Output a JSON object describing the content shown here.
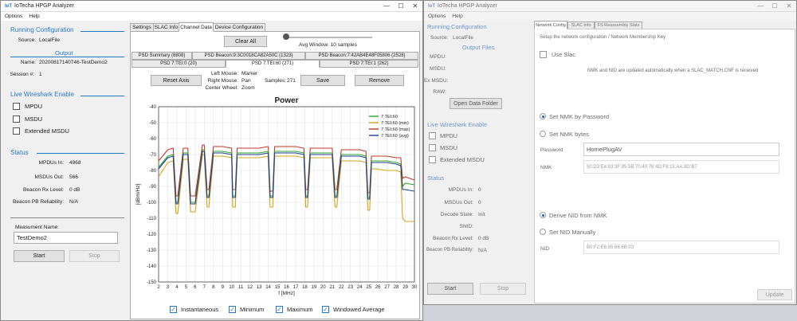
{
  "left_window": {
    "title": "IoTecha HPGP Analyzer",
    "menu": [
      "Options",
      "Help"
    ],
    "running_config": {
      "heading": "Running Configuration",
      "source_label": "Source:",
      "source_value": "LocalFile",
      "output_heading": "Output",
      "name_label": "Name:",
      "name_value": "20200817140746-TestDemo2",
      "session_label": "Session #:",
      "session_value": "1"
    },
    "wireshark": {
      "heading": "Live Wireshark Enable",
      "items": [
        "MPDU",
        "MSDU",
        "Extended MSDU"
      ]
    },
    "status": {
      "heading": "Status",
      "rows": [
        {
          "label": "MPDUs In:",
          "value": "4968"
        },
        {
          "label": "MSDUs Out:",
          "value": "566"
        },
        {
          "label": "Beacon Rx Level:",
          "value": "0 dB"
        },
        {
          "label": "Beacon PB Reliability:",
          "value": "N/A"
        }
      ]
    },
    "measurement": {
      "label": "Measument Name:",
      "value": "TestDemo2",
      "start": "Start",
      "stop": "Stop"
    },
    "tabs": [
      "Settings",
      "SLAC Info",
      "Channel Data",
      "Device Configuration"
    ],
    "clear_all": "Clear All",
    "avg_window": "Avg Window: 10 samples",
    "subtabs_row1": [
      "PSD Summary (8808)",
      "PSD Beacon:9:3C0018CA82A50C (1323)",
      "PSD Beacon:7:42AB4E48F05806 (2528)"
    ],
    "subtabs_row2": [
      "PSD 7:TEI:0 (20)",
      "PSD 7:TEI:60 (271)",
      "PSD 7:TEI:1 (262)"
    ],
    "reset_axis": "Reset Axis",
    "mouse_help": [
      {
        "k": "Left Mouse:",
        "v": "Marker"
      },
      {
        "k": "Right Mouse:",
        "v": "Pan"
      },
      {
        "k": "Center Wheel:",
        "v": "Zoom"
      }
    ],
    "samples_label": "Samples:",
    "samples_value": "271",
    "save": "Save",
    "remove": "Remove",
    "toggles": [
      "Instantaneous",
      "Minimum",
      "Maximum",
      "Windowed Average"
    ]
  },
  "chart_data": {
    "type": "line",
    "title": "Power",
    "xlabel": "f [MHz]",
    "ylabel": "[dBm/Hz]",
    "xlim": [
      2,
      30
    ],
    "ylim": [
      -150,
      -40
    ],
    "xticks": [
      2,
      3,
      4,
      5,
      6,
      7,
      8,
      9,
      10,
      11,
      12,
      13,
      14,
      15,
      16,
      17,
      18,
      19,
      20,
      21,
      22,
      23,
      24,
      25,
      26,
      27,
      28,
      29,
      30
    ],
    "yticks": [
      -40,
      -50,
      -60,
      -70,
      -80,
      -90,
      -100,
      -110,
      -120,
      -130,
      -140,
      -150
    ],
    "legend_position": "top-right",
    "grid": true,
    "x": [
      2,
      3,
      3.6,
      3.9,
      4.1,
      4.7,
      5.2,
      5.5,
      6,
      6.8,
      7,
      7.3,
      7.5,
      8,
      9,
      10,
      10.1,
      10.4,
      10.6,
      11,
      13,
      14,
      14.2,
      14.5,
      14.7,
      15,
      16,
      17,
      17.9,
      18.1,
      18.3,
      18.6,
      19,
      20,
      21,
      21.3,
      21.5,
      22,
      23,
      24,
      24.7,
      24.9,
      25.1,
      25.3,
      25.7,
      27,
      28,
      28.5,
      28.7,
      29,
      30
    ],
    "series": [
      {
        "name": "7:TEI:60",
        "color": "#2ea52e",
        "values": [
          -78,
          -71,
          -70,
          -100,
          -100,
          -69,
          -69,
          -100,
          -100,
          -67,
          -67,
          -96,
          -96,
          -68,
          -68,
          -69,
          -96,
          -96,
          -69,
          -69,
          -69,
          -68,
          -96,
          -96,
          -68,
          -68,
          -68,
          -68,
          -69,
          -96,
          -96,
          -69,
          -69,
          -69,
          -69,
          -96,
          -96,
          -70,
          -70,
          -70,
          -71,
          -97,
          -97,
          -74,
          -74,
          -74,
          -75,
          -76,
          -90,
          -88,
          -89
        ]
      },
      {
        "name": "7:TEI:60 (min)",
        "color": "#d4a41c",
        "values": [
          -84,
          -75,
          -74,
          -107,
          -107,
          -73,
          -73,
          -106,
          -106,
          -70,
          -70,
          -103,
          -103,
          -71,
          -71,
          -72,
          -103,
          -103,
          -72,
          -72,
          -72,
          -71,
          -103,
          -103,
          -71,
          -71,
          -71,
          -71,
          -72,
          -103,
          -103,
          -72,
          -72,
          -72,
          -72,
          -103,
          -103,
          -74,
          -74,
          -74,
          -75,
          -105,
          -105,
          -79,
          -79,
          -80,
          -80,
          -81,
          -110,
          -112,
          -112
        ]
      },
      {
        "name": "7:TEI:60 (max)",
        "color": "#c0392b",
        "values": [
          -74,
          -67,
          -66,
          -96,
          -96,
          -66,
          -66,
          -96,
          -96,
          -64,
          -64,
          -92,
          -92,
          -65,
          -65,
          -66,
          -92,
          -92,
          -66,
          -66,
          -66,
          -65,
          -93,
          -93,
          -65,
          -65,
          -65,
          -65,
          -66,
          -92,
          -92,
          -66,
          -66,
          -66,
          -66,
          -92,
          -92,
          -67,
          -67,
          -67,
          -68,
          -94,
          -94,
          -71,
          -71,
          -71,
          -72,
          -72,
          -85,
          -84,
          -86
        ]
      },
      {
        "name": "7:TEI:60 (avg)",
        "color": "#1d3f8f",
        "values": [
          -79,
          -72,
          -71,
          -101,
          -101,
          -70,
          -70,
          -101,
          -101,
          -68,
          -68,
          -97,
          -97,
          -69,
          -69,
          -70,
          -97,
          -97,
          -70,
          -70,
          -70,
          -69,
          -97,
          -97,
          -69,
          -69,
          -69,
          -69,
          -70,
          -97,
          -97,
          -70,
          -70,
          -70,
          -70,
          -97,
          -97,
          -71,
          -71,
          -71,
          -72,
          -98,
          -98,
          -75,
          -75,
          -75,
          -76,
          -77,
          -92,
          -92,
          -93
        ]
      }
    ]
  },
  "right_window": {
    "title": "IoTecha HPGP Analyzer",
    "menu": [
      "Options",
      "Help"
    ],
    "running_config": {
      "heading": "Running Configuration",
      "source_label": "Source:",
      "source_value": "LocalFile",
      "output_heading": "Output Files",
      "fields": [
        "MPDU:",
        "MSDU:",
        "Ex MSDU:",
        "RAW:"
      ],
      "open_folder": "Open Data Folder"
    },
    "wireshark": {
      "heading": "Live Wireshark Enable",
      "items": [
        "MPDU",
        "MSDU",
        "Extended MSDU"
      ]
    },
    "status": {
      "heading": "Status",
      "rows": [
        {
          "label": "MPDUs In:",
          "value": "0"
        },
        {
          "label": "MSDUs Out:",
          "value": "0"
        },
        {
          "label": "Decode State:",
          "value": "Init"
        },
        {
          "label": "SNID:",
          "value": ""
        },
        {
          "label": "Beacon Rx Level:",
          "value": "0 dB"
        },
        {
          "label": "Beacon PB Reliability:",
          "value": "N/A"
        }
      ]
    },
    "start": "Start",
    "stop": "Stop",
    "tabs": [
      "Network Config",
      "SLAC Info",
      "FS Reassembly Stats"
    ],
    "setup_text": "Setup the network configuration / Network Membership Key",
    "use_slac": "Use Slac",
    "nmk_note": "NMK and NID are updated automatically when a SLAC_MATCH.CNF is received",
    "set_nmk_password": "Set NMK by Password",
    "set_nmk_bytes": "Set NMK bytes",
    "password_label": "Password",
    "password_value": "HomePlugAV",
    "nmk_label": "NMK",
    "nmk_value": "50:D3:E4:93:3F:85:5B:70:40:78:4D:F8:15:AA:8D:B7",
    "derive_nid": "Derive NID from NMK",
    "set_nid_manual": "Set NID Manually",
    "nid_label": "NID",
    "nid_value": "B0:F2:E6:95:66:6B:03",
    "update": "Update"
  }
}
